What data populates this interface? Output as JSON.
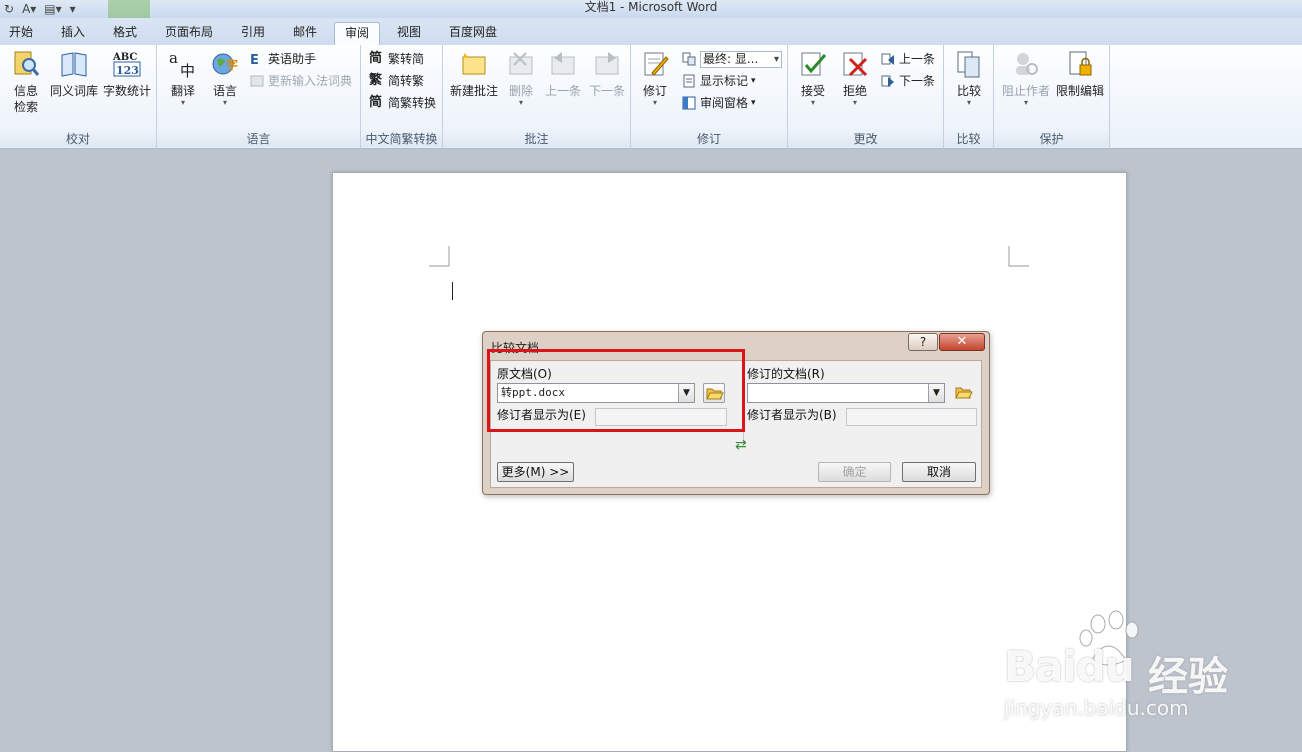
{
  "window": {
    "title": "文档1 - Microsoft Word"
  },
  "tabs": [
    {
      "label": "开始"
    },
    {
      "label": "插入"
    },
    {
      "label": "格式"
    },
    {
      "label": "页面布局"
    },
    {
      "label": "引用"
    },
    {
      "label": "邮件"
    },
    {
      "label": "审阅"
    },
    {
      "label": "视图"
    },
    {
      "label": "百度网盘"
    }
  ],
  "ribbon": {
    "proofing": {
      "label": "校对",
      "info_line1": "信息",
      "info_line2": "检索",
      "thesaurus": "同义词库",
      "word_count": "字数统计"
    },
    "language": {
      "label": "语言",
      "translate": "翻译",
      "language": "语言",
      "english_assistant": "英语助手",
      "update_ime": "更新输入法词典"
    },
    "chinese": {
      "label": "中文简繁转换",
      "to_simplified": "繁转简",
      "to_traditional": "简转繁",
      "convert": "简繁转换"
    },
    "comments": {
      "label": "批注",
      "new": "新建批注",
      "delete": "删除",
      "prev": "上一条",
      "next": "下一条"
    },
    "tracking": {
      "label": "修订",
      "track": "修订",
      "display_combo": "最终: 显...",
      "show_markup": "显示标记",
      "review_pane": "审阅窗格"
    },
    "changes": {
      "label": "更改",
      "accept": "接受",
      "reject": "拒绝",
      "prev": "上一条",
      "next": "下一条"
    },
    "compare": {
      "label": "比较",
      "compare": "比较"
    },
    "protect": {
      "label": "保护",
      "block_authors": "阻止作者",
      "restrict_editing": "限制编辑"
    }
  },
  "dialog": {
    "title": "比较文档",
    "help": "?",
    "close": "✕",
    "original_label": "原文档(O)",
    "original_value": "转ppt.docx",
    "original_author_label": "修订者显示为(E)",
    "revised_label": "修订的文档(R)",
    "revised_value": "",
    "revised_author_label": "修订者显示为(B)",
    "more_button": "更多(M) >>",
    "ok_button": "确定",
    "cancel_button": "取消"
  },
  "watermark": {
    "brand": "Baidu",
    "suffix": "经验",
    "url": "jingyan.baidu.com"
  }
}
